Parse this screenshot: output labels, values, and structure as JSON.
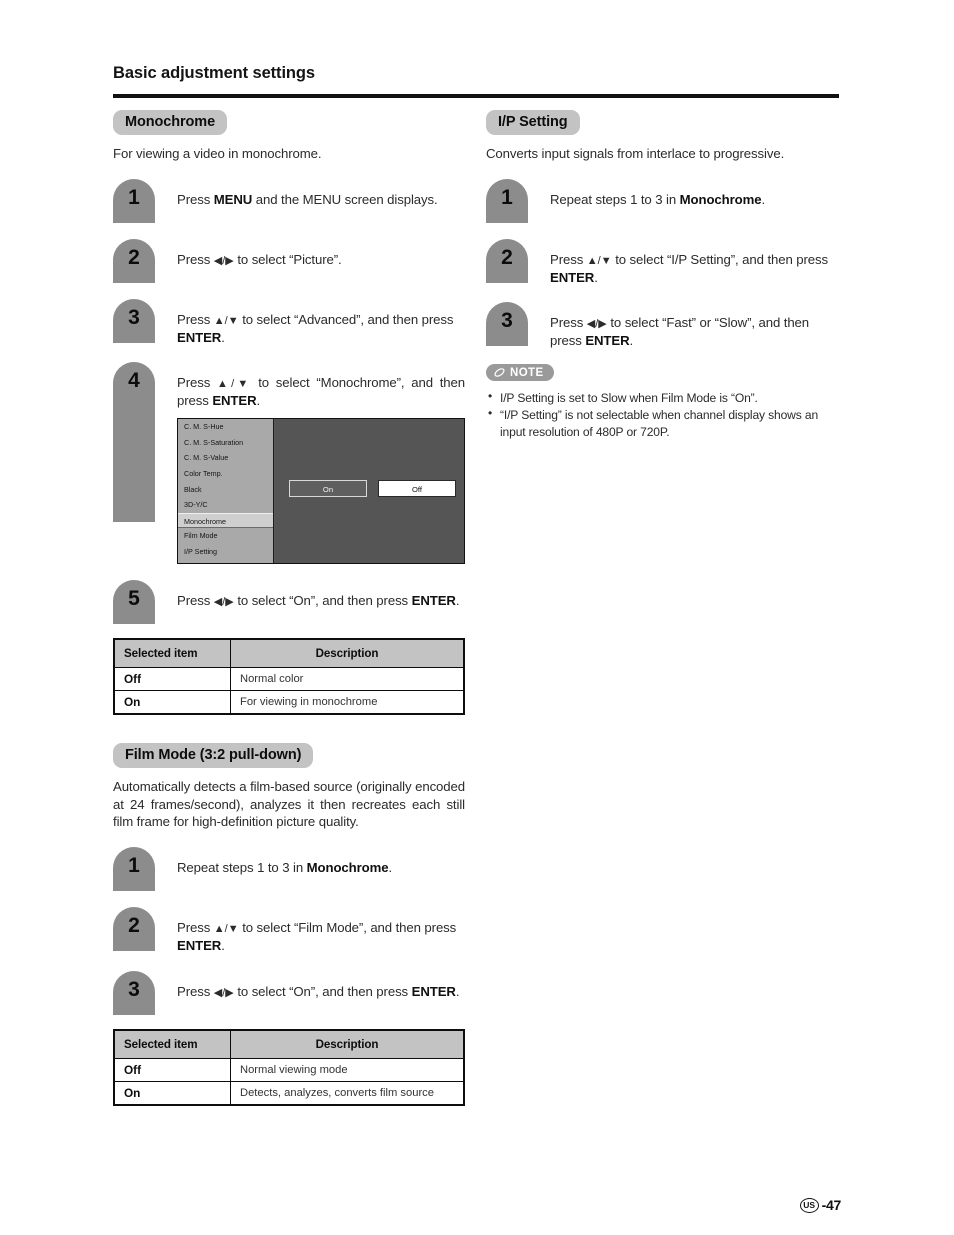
{
  "header": {
    "title": "Basic adjustment settings"
  },
  "left_column": {
    "monochrome": {
      "heading": "Monochrome",
      "description": "For viewing a video in monochrome.",
      "steps": [
        {
          "number": "1",
          "text_html": "Press <b>MENU</b> and the MENU screen displays."
        },
        {
          "number": "2",
          "text_html": "Press <span class=\"arrows\">◀/▶</span> to select “Picture”."
        },
        {
          "number": "3",
          "text_html": "Press <span class=\"arrows\">▲/▼</span> to select “Advanced”, and then press <b>ENTER</b>."
        },
        {
          "number": "4",
          "text_html": "Press <span class=\"arrows\">▲/▼</span> to select “Monochrome”, and then press <b>ENTER</b>."
        },
        {
          "number": "5",
          "text_html": "Press <span class=\"arrows\">◀/▶</span> to select “On”, and then press <b>ENTER</b>."
        }
      ],
      "osd": {
        "menu_items": [
          "C. M. S-Hue",
          "C. M. S-Saturation",
          "C. M. S-Value",
          "Color Temp.",
          "Black",
          "3D-Y/C",
          "Monochrome",
          "Film Mode",
          "I/P Setting"
        ],
        "selected_item": "Monochrome",
        "button_on": "On",
        "button_off": "Off"
      },
      "table": {
        "columns": [
          "Selected item",
          "Description"
        ],
        "rows": [
          {
            "item": "Off",
            "description": "Normal color"
          },
          {
            "item": "On",
            "description": "For viewing in monochrome"
          }
        ]
      }
    },
    "film_mode": {
      "heading": "Film Mode (3:2 pull-down)",
      "description": "Automatically detects a film-based source (originally encoded at 24 frames/second), analyzes it then recreates each still film frame for high-definition picture quality.",
      "steps": [
        {
          "number": "1",
          "text_html": "Repeat steps 1 to 3 in <b>Monochrome</b>."
        },
        {
          "number": "2",
          "text_html": "Press <span class=\"arrows\">▲/▼</span> to select “Film Mode”, and then press <b>ENTER</b>."
        },
        {
          "number": "3",
          "text_html": "Press <span class=\"arrows\">◀/▶</span> to select “On”, and then press <b>ENTER</b>."
        }
      ],
      "table": {
        "columns": [
          "Selected item",
          "Description"
        ],
        "rows": [
          {
            "item": "Off",
            "description": "Normal viewing mode"
          },
          {
            "item": "On",
            "description": "Detects, analyzes, converts film source"
          }
        ]
      }
    }
  },
  "right_column": {
    "ip_setting": {
      "heading": "I/P Setting",
      "description": "Converts input signals from interlace to progressive.",
      "steps": [
        {
          "number": "1",
          "text_html": "Repeat steps 1 to 3 in <b>Monochrome</b>."
        },
        {
          "number": "2",
          "text_html": "Press <span class=\"arrows\">▲/▼</span> to select “I/P Setting”, and then press <b>ENTER</b>."
        },
        {
          "number": "3",
          "text_html": "Press <span class=\"arrows\">◀/▶</span> to select “Fast” or “Slow”, and then press <b>ENTER</b>."
        }
      ],
      "note": {
        "label": "NOTE",
        "icon": "pencil-icon",
        "bullets": [
          "I/P Setting is set to Slow when Film Mode is “On”.",
          "“I/P Setting” is not selectable when channel display shows an input resolution of 480P or 720P."
        ]
      }
    }
  },
  "footer": {
    "region": "US",
    "page": "-47"
  },
  "colors": {
    "pill_gray": "#c3c3c3",
    "step_badge_gray": "#8c8c8c",
    "note_badge_gray": "#9a9a9a",
    "rule_black": "#111111",
    "osd_left_panel": "#a9a9a9",
    "osd_right_panel": "#555555"
  }
}
